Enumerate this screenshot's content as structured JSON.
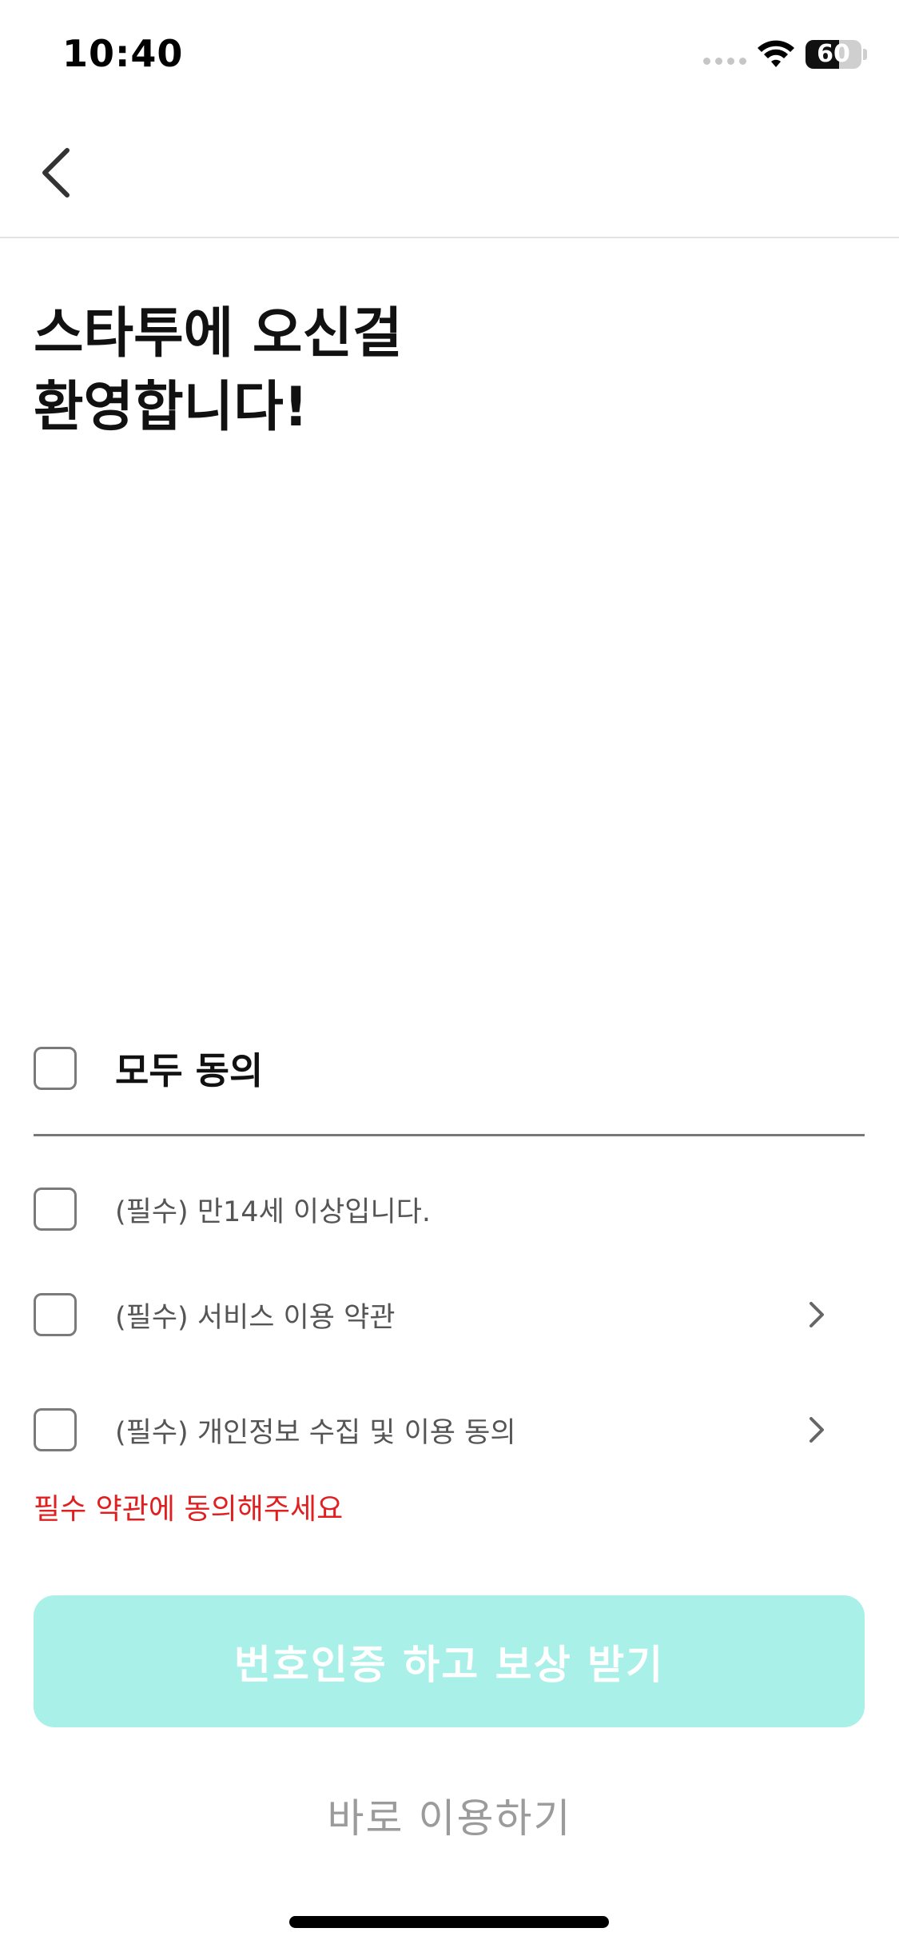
{
  "status_bar": {
    "time": "10:40",
    "battery_level": "60",
    "battery_fraction": 0.6
  },
  "nav": {
    "back_icon": "chevron-left-icon"
  },
  "welcome": {
    "title": "스타투에 오신걸\n환영합니다!"
  },
  "terms": {
    "agree_all_label": "모두 동의",
    "items": [
      {
        "label": "(필수) 만14세 이상입니다.",
        "has_arrow": false
      },
      {
        "label": "(필수) 서비스 이용 약관",
        "has_arrow": true
      },
      {
        "label": "(필수) 개인정보 수집 및 이용 동의",
        "has_arrow": true
      }
    ],
    "error_message": "필수 약관에 동의해주세요"
  },
  "actions": {
    "primary_label": "번호인증 하고 보상 받기",
    "secondary_label": "바로 이용하기"
  },
  "colors": {
    "primary_button_bg": "#a8f0e8",
    "error": "#e02020"
  }
}
